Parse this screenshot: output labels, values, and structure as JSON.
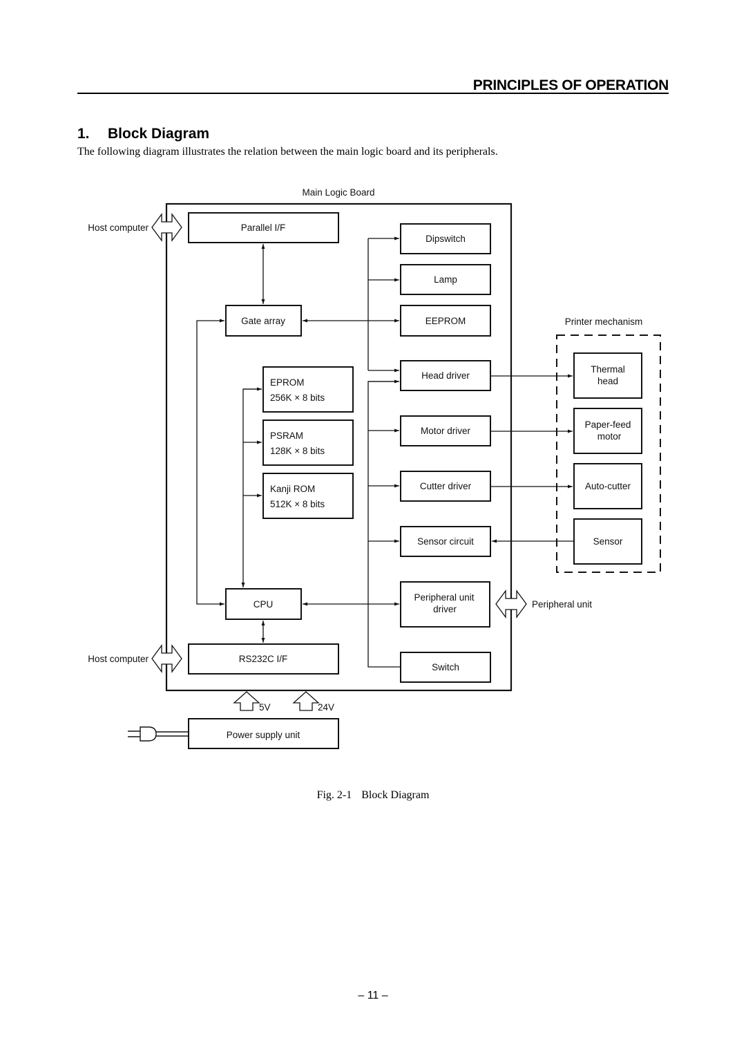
{
  "header": {
    "running_title": "PRINCIPLES OF OPERATION"
  },
  "section": {
    "number": "1.",
    "title": "Block Diagram"
  },
  "intro": "The following diagram illustrates the relation between the main logic board and its peripherals.",
  "diagram": {
    "main_board_label": "Main Logic Board",
    "printer_mechanism_label": "Printer mechanism",
    "external": {
      "host_computer_top": "Host computer",
      "host_computer_bottom": "Host computer",
      "peripheral_unit": "Peripheral unit"
    },
    "blocks": {
      "parallel_if": "Parallel I/F",
      "gate_array": "Gate array",
      "eprom": {
        "line1": "EPROM",
        "line2": "256K × 8 bits"
      },
      "psram": {
        "line1": "PSRAM",
        "line2": "128K × 8 bits"
      },
      "kanji_rom": {
        "line1": "Kanji ROM",
        "line2": "512K × 8 bits"
      },
      "cpu": "CPU",
      "rs232c_if": "RS232C I/F",
      "dipswitch": "Dipswitch",
      "lamp": "Lamp",
      "eeprom": "EEPROM",
      "head_driver": "Head driver",
      "motor_driver": "Motor driver",
      "cutter_driver": "Cutter driver",
      "sensor_circuit": "Sensor circuit",
      "peripheral_unit_driver": {
        "line1": "Peripheral unit",
        "line2": "driver"
      },
      "switch": "Switch",
      "thermal_head": {
        "line1": "Thermal",
        "line2": "head"
      },
      "paper_feed_motor": {
        "line1": "Paper-feed",
        "line2": "motor"
      },
      "auto_cutter": "Auto-cutter",
      "sensor": "Sensor",
      "power_supply_unit": "Power supply unit"
    },
    "power": {
      "v5": "5V",
      "v24": "24V"
    }
  },
  "caption": {
    "fig": "Fig. 2-1",
    "title": "Block Diagram"
  },
  "page_number": "– 11 –"
}
